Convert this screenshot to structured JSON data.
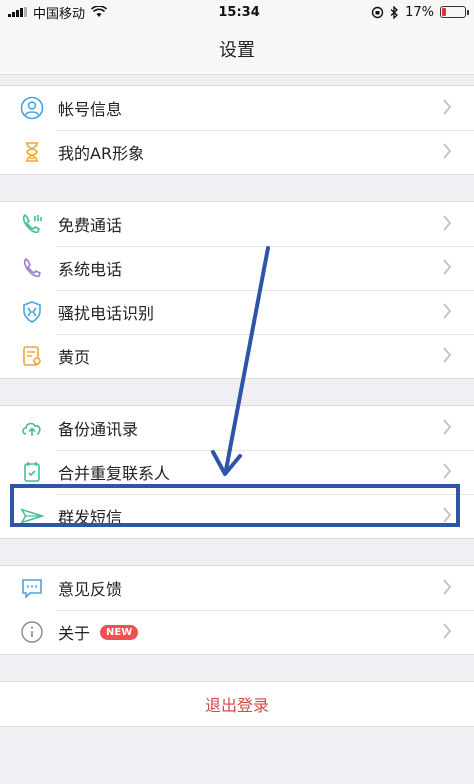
{
  "status_bar": {
    "carrier": "中国移动",
    "time": "15:34",
    "battery": "17%",
    "battery_level": 0.17
  },
  "nav": {
    "title": "设置"
  },
  "groups": [
    [
      {
        "label": "帐号信息",
        "icon": "person-icon"
      },
      {
        "label": "我的AR形象",
        "icon": "hourglass-icon"
      }
    ],
    [
      {
        "label": "免费通话",
        "icon": "free-call-icon"
      },
      {
        "label": "系统电话",
        "icon": "phone-icon"
      },
      {
        "label": "骚扰电话识别",
        "icon": "shield-phone-icon"
      },
      {
        "label": "黄页",
        "icon": "yellow-pages-icon"
      }
    ],
    [
      {
        "label": "备份通讯录",
        "icon": "cloud-upload-icon"
      },
      {
        "label": "合并重复联系人",
        "icon": "merge-contacts-icon"
      },
      {
        "label": "群发短信",
        "icon": "paper-plane-icon"
      }
    ],
    [
      {
        "label": "意见反馈",
        "icon": "feedback-icon"
      },
      {
        "label": "关于",
        "icon": "info-icon",
        "badge": "NEW"
      }
    ]
  ],
  "logout": {
    "label": "退出登录"
  },
  "colors": {
    "highlight": "#2f55a8",
    "logout": "#d24a4a",
    "badge": "#f0504f",
    "icon_blue": "#4aa3df",
    "icon_orange": "#f2a532",
    "icon_green": "#46c08a",
    "icon_purple": "#9d7fd0"
  }
}
